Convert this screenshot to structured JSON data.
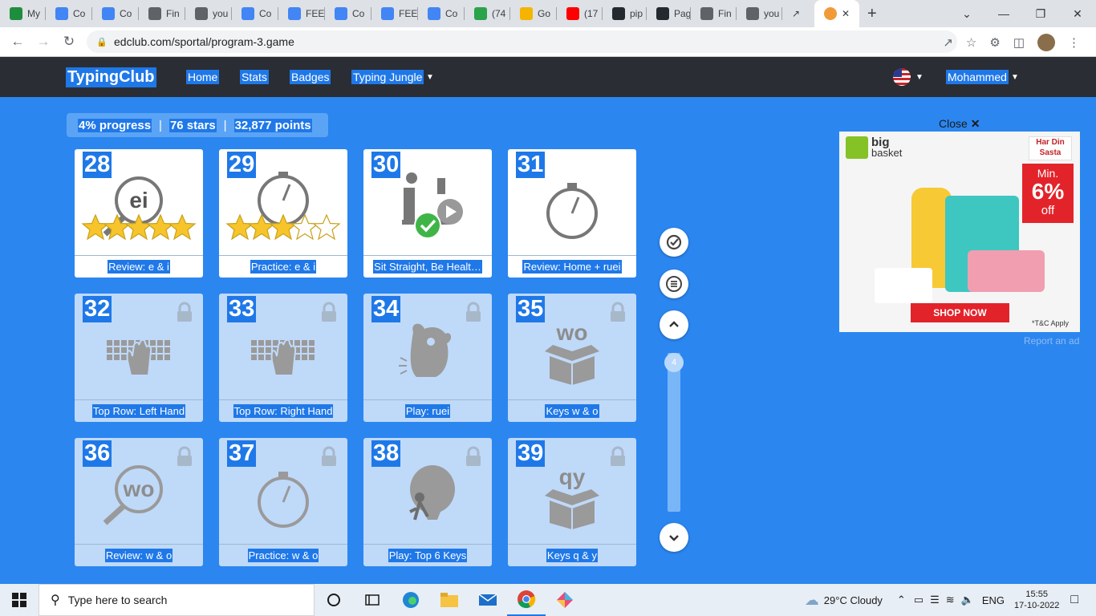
{
  "browser": {
    "tabs": [
      {
        "label": "My",
        "color": "#1e8e3e"
      },
      {
        "label": "Co",
        "color": "#4285f4"
      },
      {
        "label": "Co",
        "color": "#4285f4"
      },
      {
        "label": "Fin",
        "color": "#5f6368"
      },
      {
        "label": "you",
        "color": "#5f6368"
      },
      {
        "label": "Co",
        "color": "#4285f4"
      },
      {
        "label": "FEE",
        "color": "#4285f4"
      },
      {
        "label": "Co",
        "color": "#4285f4"
      },
      {
        "label": "FEE",
        "color": "#4285f4"
      },
      {
        "label": "Co",
        "color": "#4285f4"
      },
      {
        "label": "(74",
        "color": "#2aa34a"
      },
      {
        "label": "Go",
        "color": "#f4b400"
      },
      {
        "label": "(17",
        "color": "#ff0000"
      },
      {
        "label": "pip",
        "color": "#24292f"
      },
      {
        "label": "Pag",
        "color": "#24292f"
      },
      {
        "label": "Fin",
        "color": "#5f6368"
      },
      {
        "label": "you",
        "color": "#5f6368"
      }
    ],
    "url": "edclub.com/sportal/program-3.game"
  },
  "site": {
    "logo": "TypingClub",
    "nav": {
      "home": "Home",
      "stats": "Stats",
      "badges": "Badges",
      "jungle": "Typing Jungle"
    },
    "user": "Mohammed"
  },
  "progress": {
    "percent": "4% progress",
    "stars": "76 stars",
    "points": "32,877 points"
  },
  "lessons": [
    {
      "num": "28",
      "label": "Review: e & i",
      "locked": false,
      "icon": "magnifier-icon",
      "text": "ei",
      "stars": 5
    },
    {
      "num": "29",
      "label": "Practice: e & i",
      "locked": false,
      "icon": "stopwatch-icon",
      "stars": 3
    },
    {
      "num": "30",
      "label": "Sit Straight, Be Healt…",
      "locked": false,
      "icon": "posture-video-icon"
    },
    {
      "num": "31",
      "label": "Review: Home + ruei",
      "locked": false,
      "icon": "stopwatch-icon"
    },
    {
      "num": "32",
      "label": "Top Row: Left Hand",
      "locked": true,
      "icon": "keyboard-hand-icon"
    },
    {
      "num": "33",
      "label": "Top Row: Right Hand",
      "locked": true,
      "icon": "keyboard-hand-icon"
    },
    {
      "num": "34",
      "label": "Play: ruei",
      "locked": true,
      "icon": "monster-icon"
    },
    {
      "num": "35",
      "label": "Keys w & o",
      "locked": true,
      "icon": "box-icon",
      "text": "wo"
    },
    {
      "num": "36",
      "label": "Review: w & o",
      "locked": true,
      "icon": "magnifier-icon",
      "text": "wo"
    },
    {
      "num": "37",
      "label": "Practice: w & o",
      "locked": true,
      "icon": "stopwatch-icon"
    },
    {
      "num": "38",
      "label": "Play: Top 6 Keys",
      "locked": true,
      "icon": "balloon-icon"
    },
    {
      "num": "39",
      "label": "Keys q & y",
      "locked": true,
      "icon": "box-icon",
      "text": "qy"
    }
  ],
  "scroll": {
    "level": "4"
  },
  "ad": {
    "close": "Close",
    "brand1": "big",
    "brand2": "basket",
    "tag": "Har Din Sasta",
    "min": "Min.",
    "pct": "6%",
    "off": "off",
    "cta": "SHOP NOW",
    "tnc": "*T&C Apply",
    "report": "Report an ad"
  },
  "taskbar": {
    "search_placeholder": "Type here to search",
    "weather": "29°C  Cloudy",
    "lang": "ENG",
    "time": "15:55",
    "date": "17-10-2022"
  }
}
